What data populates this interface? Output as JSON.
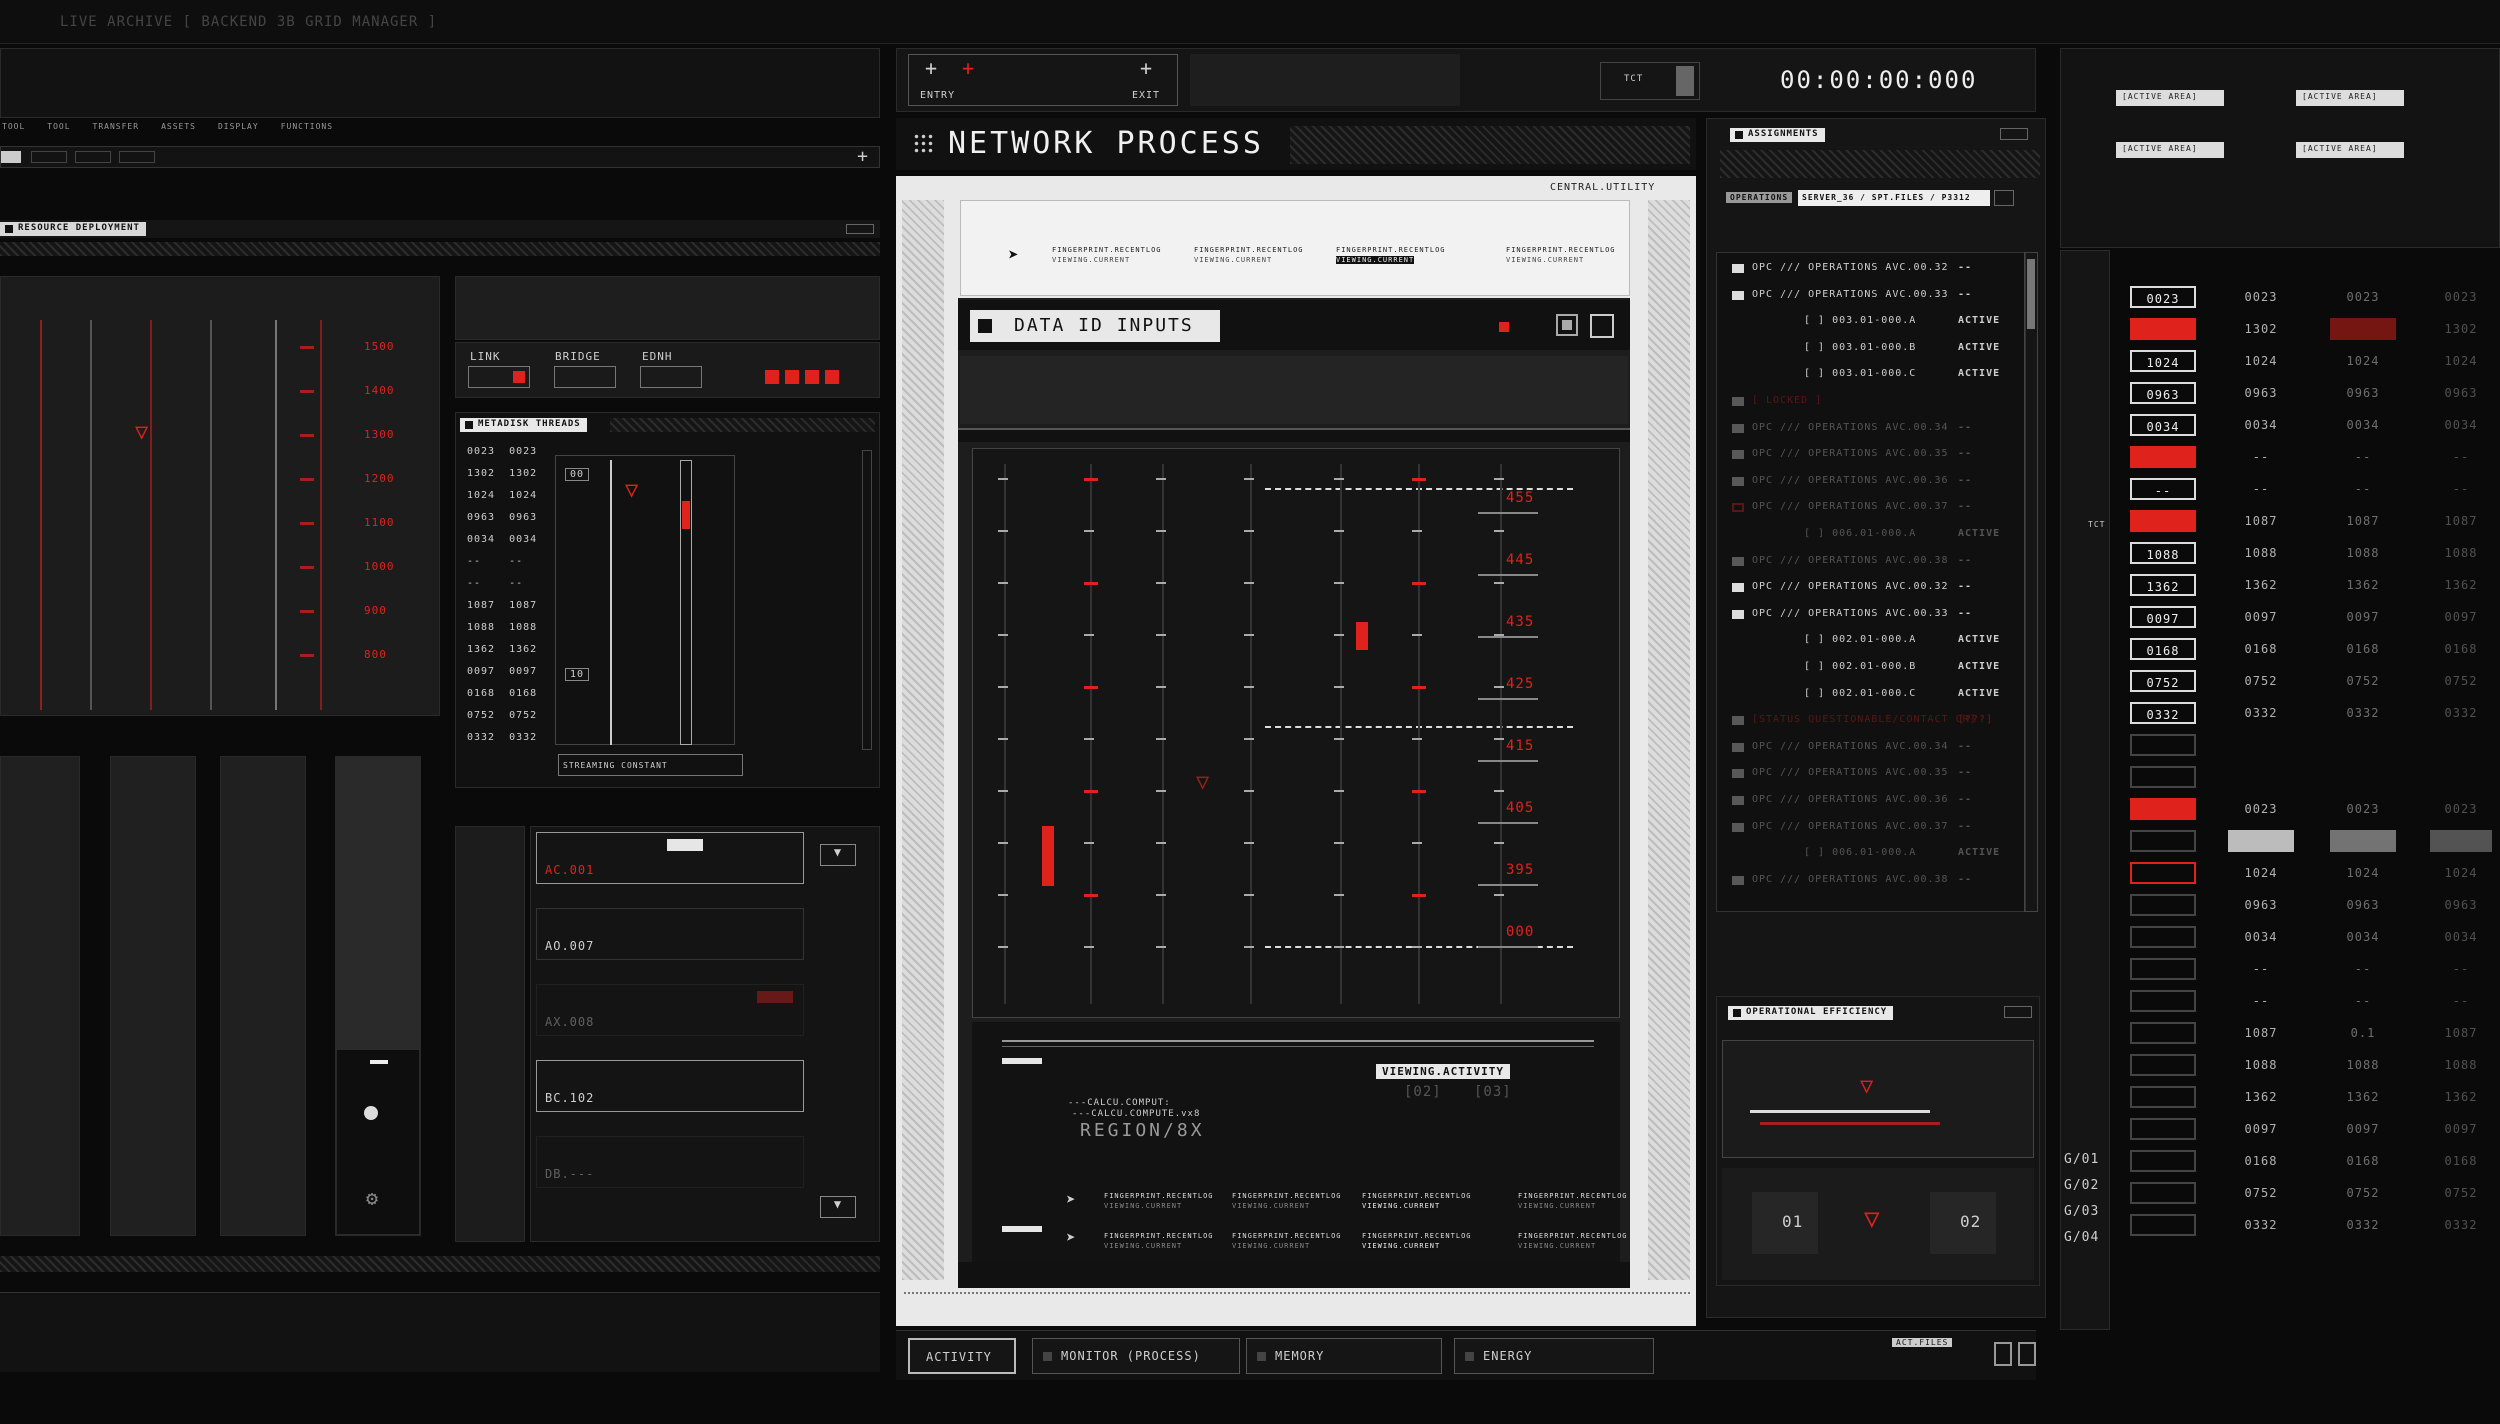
{
  "top_bar": {
    "title": "LIVE ARCHIVE [ BACKEND 3B GRID MANAGER ]"
  },
  "left_tabs": [
    "TOOL",
    "TOOL",
    "TRANSFER",
    "ASSETS",
    "DISPLAY",
    "FUNCTIONS"
  ],
  "left_tab_plus": "+",
  "resource_panel": {
    "title": "RESOURCE DEPLOYMENT",
    "scale": [
      "1500",
      "1400",
      "1300",
      "1200",
      "1100",
      "1000",
      "900",
      "800"
    ]
  },
  "connection": {
    "link": "LINK",
    "bridge": "BRIDGE",
    "ednh": "EDNH"
  },
  "metadisk": {
    "title": "METADISK THREADS",
    "rows": [
      "0023  0023",
      "1302  1302",
      "1024  1024",
      "0963  0963",
      "0034  0034",
      "--    --",
      "--    --",
      "1087  1087",
      "1088  1088",
      "1362  1362",
      "0097  0097",
      "0168  0168",
      "0752  0752",
      "0332  0332"
    ],
    "streaming": "STREAMING CONSTANT",
    "labels": {
      "a": "00",
      "b": "10"
    }
  },
  "list_items": [
    "AC.001",
    "AO.007",
    "AX.008",
    "BC.102",
    "DB.---"
  ],
  "header": {
    "plus": "+",
    "entry": "ENTRY",
    "exit": "EXIT",
    "tct": "TCT",
    "timer": "00:00:00:000"
  },
  "network": {
    "title": "NETWORK PROCESS",
    "subtitle": "CENTRAL.UTILITY"
  },
  "data_panel": {
    "title": "DATA ID INPUTS",
    "fingerprint": "FINGERPRINT.RECENTLOG",
    "viewing_current": "VIEWING.CURRENT",
    "scale": [
      "455",
      "445",
      "435",
      "425",
      "415",
      "405",
      "395",
      "000"
    ],
    "viewing_activity": "VIEWING.ACTIVITY",
    "act_nums": [
      "[02]",
      "[03]"
    ],
    "calc1": "---CALCU.COMPUT:",
    "calc2": "---CALCU.COMPUTE.vx8",
    "region": "REGION/8X"
  },
  "bottom_tabs": [
    "ACTIVITY",
    "MONITOR (PROCESS)",
    "MEMORY",
    "ENERGY"
  ],
  "assignments": {
    "title": "ASSIGNMENTS",
    "operations_label": "OPERATIONS",
    "path": "SERVER_36 / SPT.FILES / P3312",
    "rows": [
      {
        "text": "OPC /// OPERATIONS AVC.00.32",
        "status": "--",
        "icon": "w",
        "dim": false,
        "indent": false
      },
      {
        "text": "OPC /// OPERATIONS AVC.00.33",
        "status": "--",
        "icon": "w",
        "dim": false,
        "indent": false
      },
      {
        "text": "[ ] 003.01-000.A",
        "status": "ACTIVE",
        "icon": "",
        "dim": false,
        "indent": true
      },
      {
        "text": "[ ] 003.01-000.B",
        "status": "ACTIVE",
        "icon": "",
        "dim": false,
        "indent": true
      },
      {
        "text": "[ ] 003.01-000.C",
        "status": "ACTIVE",
        "icon": "",
        "dim": false,
        "indent": true
      },
      {
        "text": "[ LOCKED ]",
        "status": "",
        "icon": "w",
        "dim": true,
        "indent": false,
        "red": true
      },
      {
        "text": "OPC /// OPERATIONS AVC.00.34",
        "status": "--",
        "icon": "w",
        "dim": true,
        "indent": false
      },
      {
        "text": "OPC /// OPERATIONS AVC.00.35",
        "status": "--",
        "icon": "w",
        "dim": true,
        "indent": false
      },
      {
        "text": "OPC /// OPERATIONS AVC.00.36",
        "status": "--",
        "icon": "w",
        "dim": true,
        "indent": false
      },
      {
        "text": "OPC /// OPERATIONS AVC.00.37",
        "status": "--",
        "icon": "r",
        "dim": true,
        "indent": false
      },
      {
        "text": "[ ] 006.01-000.A",
        "status": "ACTIVE",
        "icon": "",
        "dim": true,
        "indent": true
      },
      {
        "text": "OPC /// OPERATIONS AVC.00.38",
        "status": "--",
        "icon": "w",
        "dim": true,
        "indent": false
      },
      {
        "text": "OPC /// OPERATIONS AVC.00.32",
        "status": "--",
        "icon": "w",
        "dim": false,
        "indent": false
      },
      {
        "text": "OPC /// OPERATIONS AVC.00.33",
        "status": "--",
        "icon": "w",
        "dim": false,
        "indent": false
      },
      {
        "text": "[ ] 002.01-000.A",
        "status": "ACTIVE",
        "icon": "",
        "dim": false,
        "indent": true
      },
      {
        "text": "[ ] 002.01-000.B",
        "status": "ACTIVE",
        "icon": "",
        "dim": false,
        "indent": true
      },
      {
        "text": "[ ] 002.01-000.C",
        "status": "ACTIVE",
        "icon": "",
        "dim": false,
        "indent": true
      },
      {
        "text": "[STATUS QUESTIONABLE/CONTACT CR]",
        "status": "[???]",
        "icon": "w",
        "dim": true,
        "indent": false,
        "red": true
      },
      {
        "text": "OPC /// OPERATIONS AVC.00.34",
        "status": "--",
        "icon": "w",
        "dim": true,
        "indent": false
      },
      {
        "text": "OPC /// OPERATIONS AVC.00.35",
        "status": "--",
        "icon": "w",
        "dim": true,
        "indent": false
      },
      {
        "text": "OPC /// OPERATIONS AVC.00.36",
        "status": "--",
        "icon": "w",
        "dim": true,
        "indent": false
      },
      {
        "text": "OPC /// OPERATIONS AVC.00.37",
        "status": "--",
        "icon": "w",
        "dim": true,
        "indent": false
      },
      {
        "text": "[ ] 006.01-000.A",
        "status": "ACTIVE",
        "icon": "",
        "dim": true,
        "indent": true
      },
      {
        "text": "OPC /// OPERATIONS AVC.00.38",
        "status": "--",
        "icon": "w",
        "dim": true,
        "indent": false
      }
    ]
  },
  "efficiency": {
    "title": "OPERATIONAL EFFICIENCY",
    "btn1": "01",
    "btn2": "02"
  },
  "bottom_right": {
    "label": "ACT.FILES"
  },
  "right": {
    "active_area": "[ACTIVE AREA]",
    "tct": "TCT",
    "g_labels": [
      "G/01",
      "G/02",
      "G/03",
      "G/04"
    ],
    "columns": [
      [
        "0023",
        "*r",
        "1024",
        "0963",
        "0034",
        "*r",
        "--",
        "*r",
        "1088",
        "1362",
        "0097",
        "0168",
        "0752",
        "0332",
        "",
        "",
        "*r",
        "",
        "*ro",
        "",
        "",
        "",
        "",
        "",
        "",
        "",
        "",
        "",
        "",
        ""
      ],
      [
        "0023",
        "1302",
        "1024",
        "0963",
        "0034",
        "--",
        "--",
        "1087",
        "1088",
        "1362",
        "0097",
        "0168",
        "0752",
        "0332",
        "",
        "",
        "0023",
        "*w",
        "1024",
        "0963",
        "0034",
        "--",
        "--",
        "1087",
        "1088",
        "1362",
        "0097",
        "0168",
        "0752",
        "0332"
      ],
      [
        "0023",
        "*r",
        "1024",
        "0963",
        "0034",
        "--",
        "--",
        "1087",
        "1088",
        "1362",
        "0097",
        "0168",
        "0752",
        "0332",
        "",
        "",
        "0023",
        "*w",
        "1024",
        "0963",
        "0034",
        "--",
        "--",
        "0.1",
        "1088",
        "1362",
        "0097",
        "0168",
        "0752",
        "0332"
      ],
      [
        "0023",
        "1302",
        "1024",
        "0963",
        "0034",
        "--",
        "--",
        "1087",
        "1088",
        "1362",
        "0097",
        "0168",
        "0752",
        "0332",
        "",
        "",
        "0023",
        "*w",
        "1024",
        "0963",
        "0034",
        "--",
        "--",
        "1087",
        "1088",
        "1362",
        "0097",
        "0168",
        "0752",
        "0332"
      ]
    ]
  }
}
